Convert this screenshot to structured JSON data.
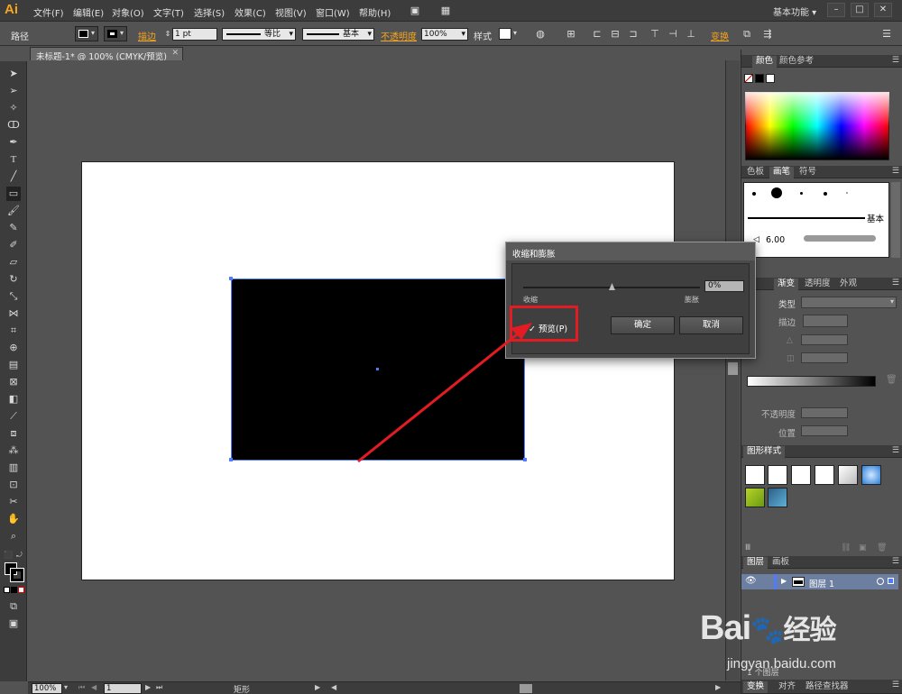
{
  "app": {
    "logo": "Ai",
    "workspace": "基本功能"
  },
  "menu": [
    "文件(F)",
    "编辑(E)",
    "对象(O)",
    "文字(T)",
    "选择(S)",
    "效果(C)",
    "视图(V)",
    "窗口(W)",
    "帮助(H)"
  ],
  "window_controls": {
    "minimize": "–",
    "restore": "□",
    "close": "✕"
  },
  "control_bar": {
    "object_type": "路径",
    "stroke_label": "描边",
    "stroke_weight": "1 pt",
    "stroke_profile_label": "等比",
    "brush_label": "基本",
    "opacity_label": "不透明度",
    "opacity_value": "100%",
    "style_label": "样式",
    "transform_label": "变换"
  },
  "document": {
    "tab_label": "未标题-1* @ 100% (CMYK/预览)"
  },
  "status_bar": {
    "zoom": "100%",
    "page": "1",
    "tool_label": "矩形"
  },
  "dialog": {
    "title": "收缩和膨胀",
    "value": "0%",
    "slider_min_label": "收缩",
    "slider_max_label": "膨胀",
    "preview_checked": true,
    "preview_label": "预览(P)",
    "ok_label": "确定",
    "cancel_label": "取消"
  },
  "panels": {
    "color": {
      "tabs": [
        "颜色",
        "颜色参考"
      ]
    },
    "brushes": {
      "tabs": [
        "色板",
        "画笔",
        "符号"
      ],
      "basic_label": "基本",
      "size_label": "6.00"
    },
    "gradient": {
      "tabs": [
        "渐变",
        "透明度",
        "外观"
      ],
      "type_label": "类型",
      "stroke_label": "描边",
      "opacity_label": "不透明度",
      "position_label": "位置"
    },
    "graphic_styles": {
      "tabs": [
        "图形样式"
      ]
    },
    "layers": {
      "tabs": [
        "图层",
        "画板"
      ],
      "layer_name": "图层 1",
      "footer_count": "1 个图层"
    },
    "bottom": {
      "tabs": [
        "变换",
        "对齐",
        "路径查找器"
      ]
    }
  },
  "watermark": {
    "brand": "Bai",
    "brand_cn": "经验",
    "url": "jingyan.baidu.com"
  },
  "colors": {
    "accent": "#f7a51e",
    "annotation": "#e31b23",
    "selection": "#4f7bff"
  }
}
